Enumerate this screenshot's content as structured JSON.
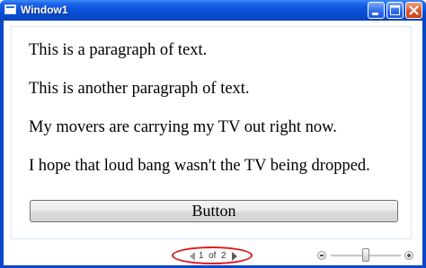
{
  "window": {
    "title": "Window1"
  },
  "titlebar_buttons": [
    "minimize",
    "maximize",
    "close"
  ],
  "document": {
    "paragraphs": [
      "This is a paragraph of text.",
      "This is another paragraph of text.",
      "My movers are carrying my TV out right now.",
      "I hope that loud bang wasn't the TV being dropped."
    ],
    "button_label": "Button"
  },
  "statusbar": {
    "page_current": "1",
    "page_of": "of",
    "page_total": "2",
    "zoom_level": 0.5
  },
  "colors": {
    "titlebar": "#0a4fd8",
    "highlight_ellipse": "#e01818"
  },
  "icons": {
    "prev": "triangle-left-icon",
    "next": "triangle-right-icon",
    "zoom_out": "minus-circle-icon",
    "zoom_in": "plus-circle-icon"
  }
}
